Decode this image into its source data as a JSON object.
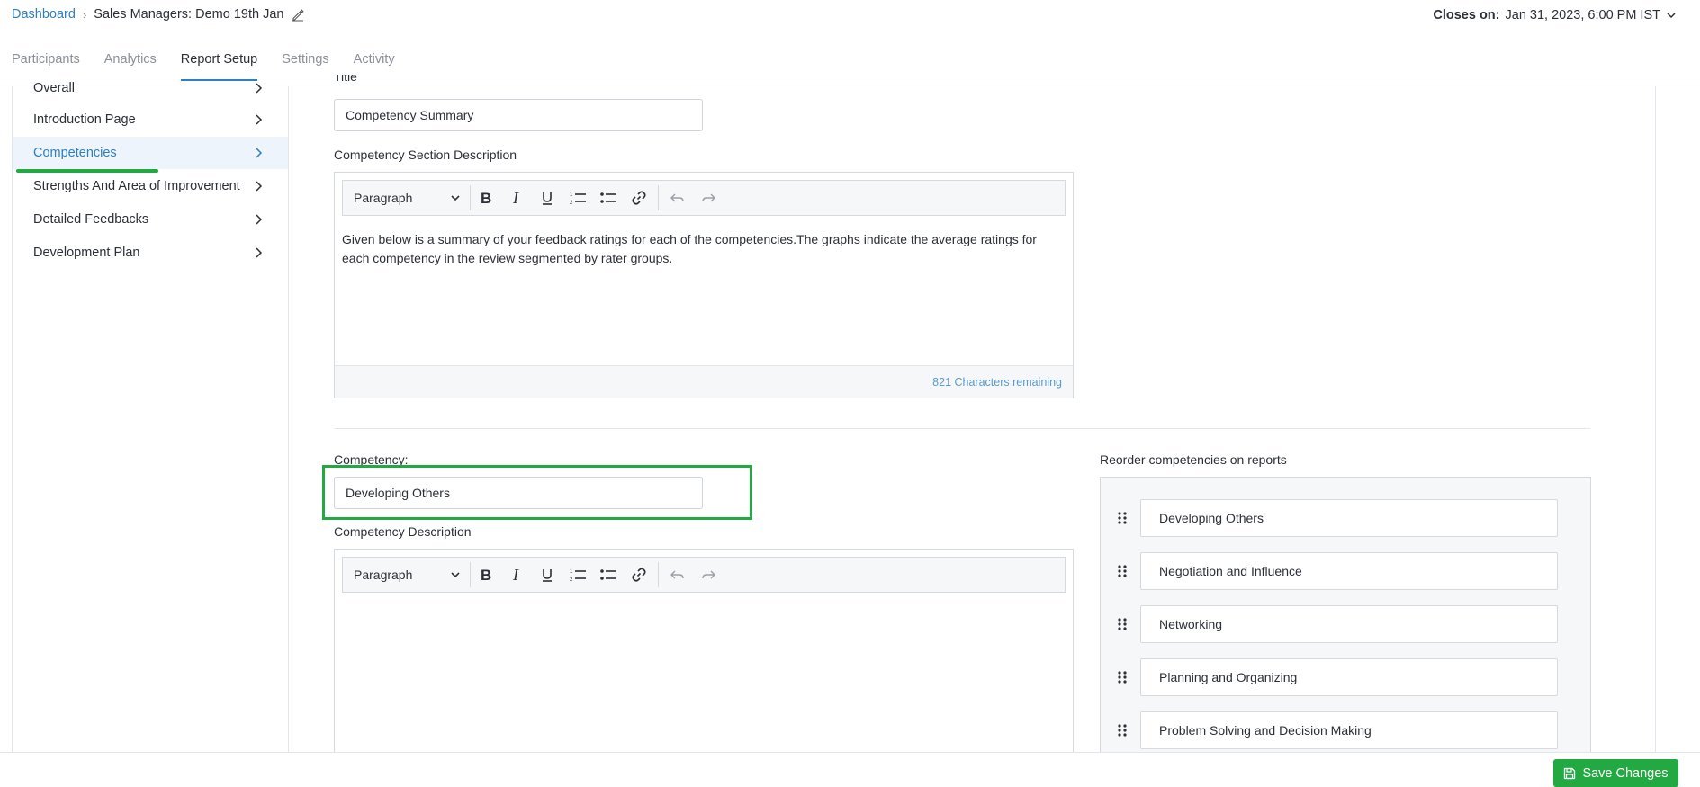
{
  "header": {
    "breadcrumb_root": "Dashboard",
    "page_title": "Sales Managers: Demo 19th Jan",
    "closes_label": "Closes on:",
    "closes_value": "Jan 31, 2023, 6:00 PM IST"
  },
  "tabs": [
    {
      "label": "Participants",
      "active": false
    },
    {
      "label": "Analytics",
      "active": false
    },
    {
      "label": "Report Setup",
      "active": true
    },
    {
      "label": "Settings",
      "active": false
    },
    {
      "label": "Activity",
      "active": false
    }
  ],
  "sidebar": {
    "items": [
      {
        "label": "Overall"
      },
      {
        "label": "Introduction Page"
      },
      {
        "label": "Competencies",
        "active": true
      },
      {
        "label": "Strengths And Area of Improvement"
      },
      {
        "label": "Detailed Feedbacks"
      },
      {
        "label": "Development Plan"
      }
    ]
  },
  "section": {
    "title_label": "Title",
    "title_value": "Competency Summary",
    "desc_label": "Competency Section Description",
    "editor1": {
      "format": "Paragraph",
      "body": "Given below is a summary of your feedback ratings for each of the competencies.The graphs indicate the average ratings for each competency in the review segmented by rater groups.",
      "remaining": "821 Characters remaining"
    }
  },
  "competency": {
    "label": "Competency:",
    "value": "Developing Others",
    "desc_label": "Competency Description",
    "editor2": {
      "format": "Paragraph"
    }
  },
  "reorder": {
    "label": "Reorder competencies on reports",
    "items": [
      "Developing Others",
      "Negotiation and Influence",
      "Networking",
      "Planning and Organizing",
      "Problem Solving and Decision Making"
    ]
  },
  "footer": {
    "save_label": "Save Changes"
  },
  "colors": {
    "accent": "#2d7fc1",
    "success": "#23a942"
  }
}
